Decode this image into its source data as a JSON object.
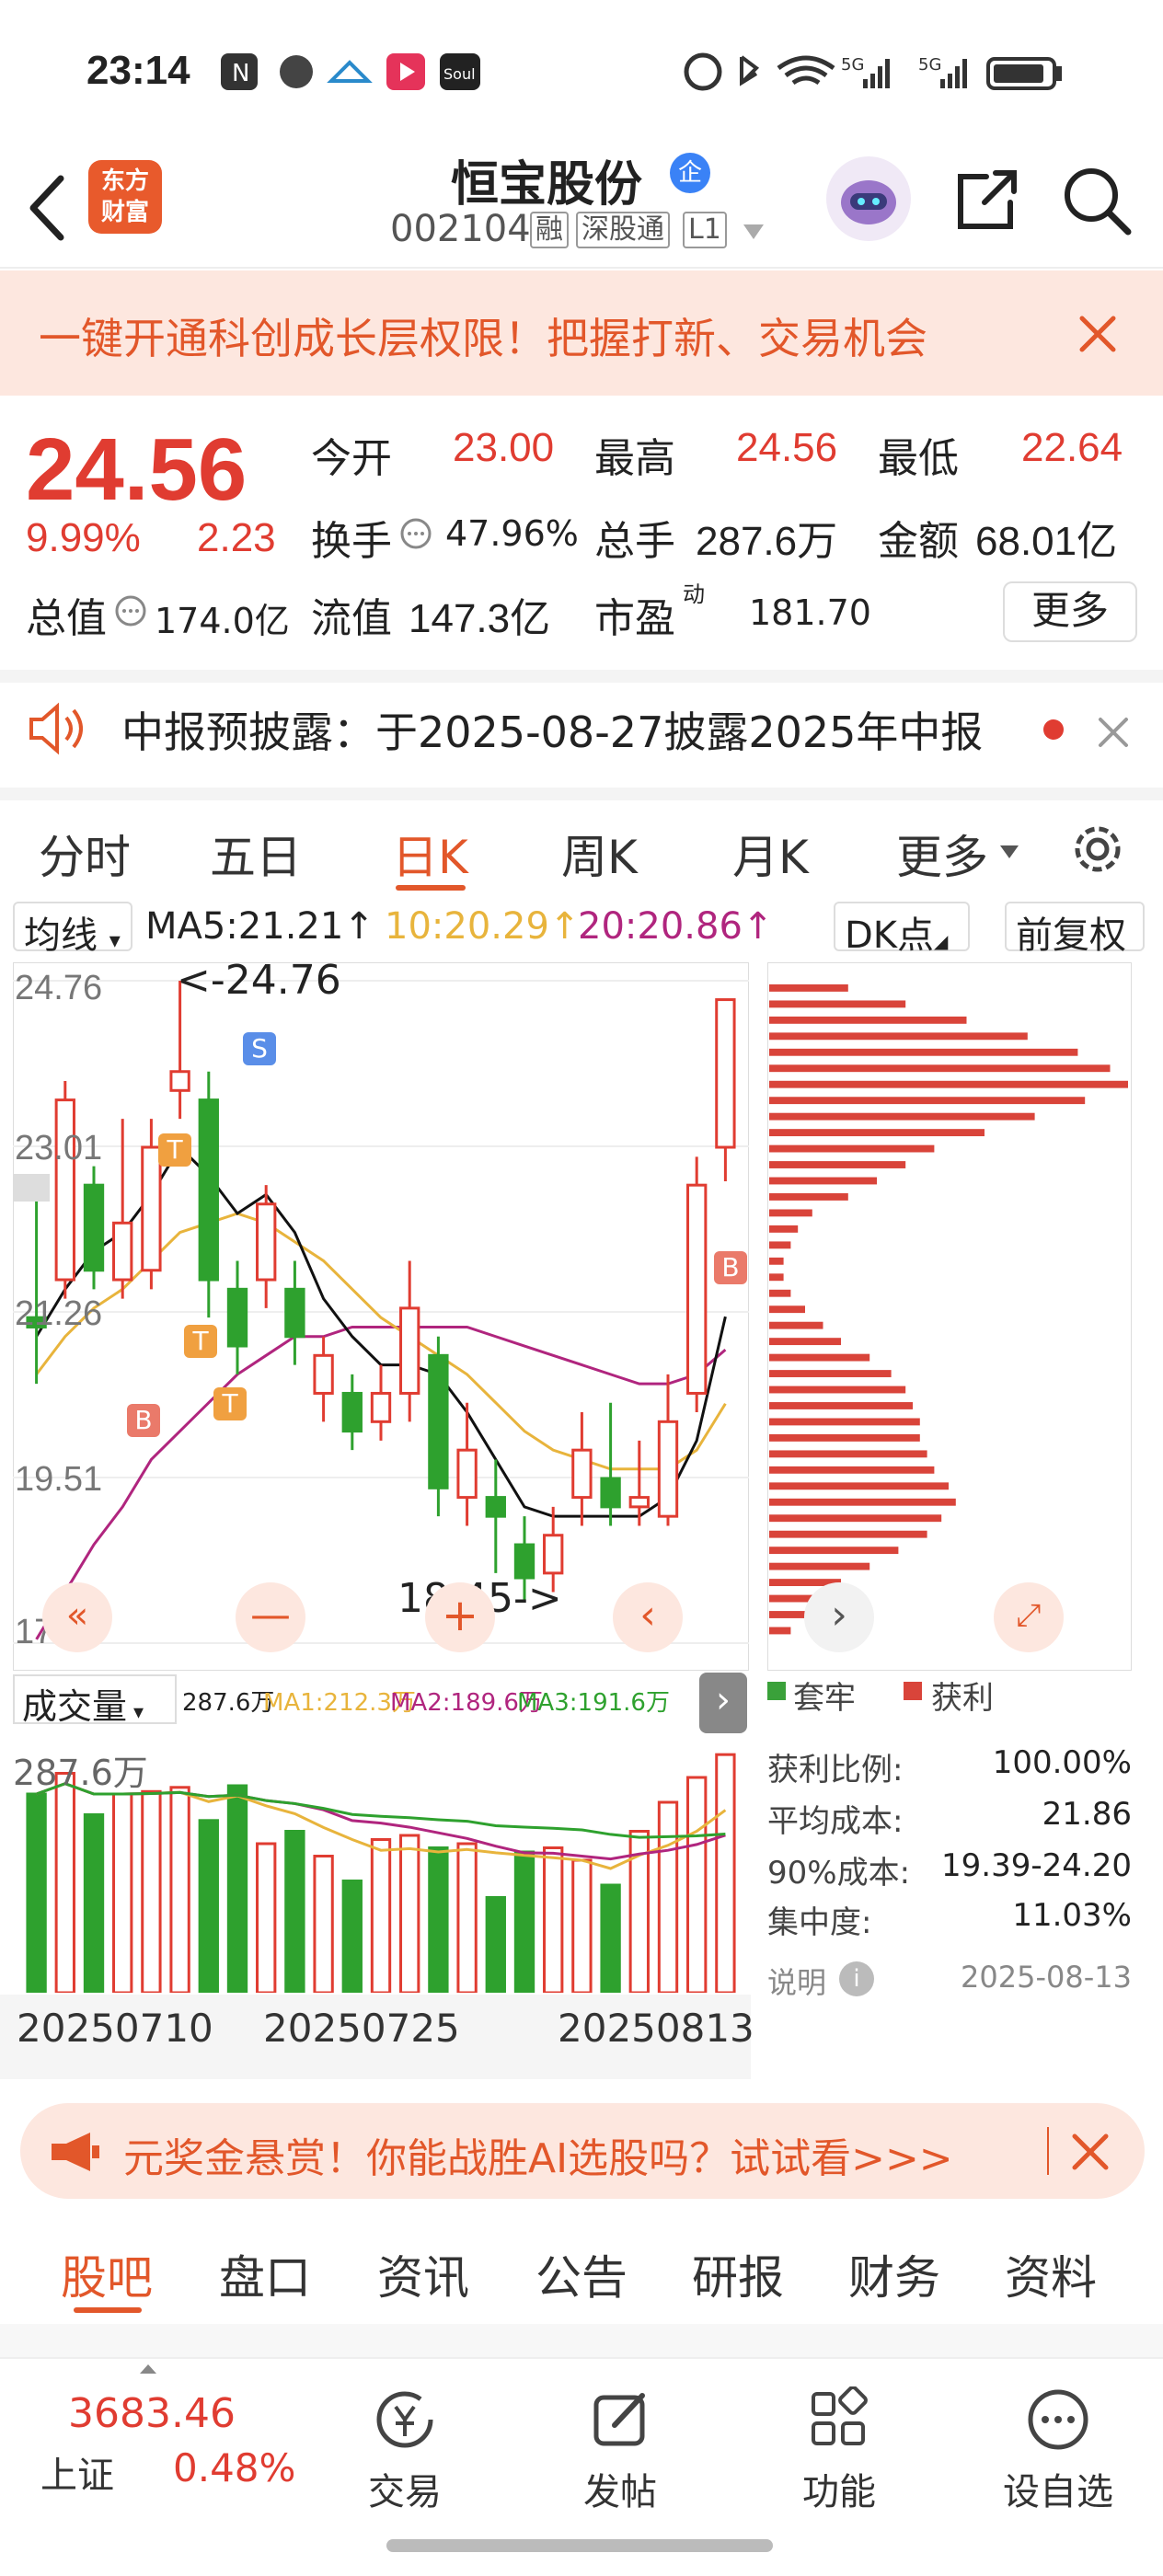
{
  "status": {
    "time": "23:14",
    "network_labels": [
      "5G",
      "5G"
    ]
  },
  "header": {
    "name": "恒宝股份",
    "badge": "企",
    "code": "002104",
    "tags": [
      "融",
      "深股通",
      "L1"
    ],
    "logo_text": "东方财富",
    "icons": [
      "back-arrow-icon",
      "avatar",
      "share-icon",
      "search-icon"
    ]
  },
  "banner": {
    "text": "一键开通科创成长层权限！把握打新、交易机会"
  },
  "quote": {
    "price": "24.56",
    "pct": "9.99%",
    "chg": "2.23",
    "open_label": "今开",
    "open": "23.00",
    "high_label": "最高",
    "high": "24.56",
    "low_label": "最低",
    "low": "22.64",
    "turnover_label": "换手",
    "turnover": "47.96%",
    "vol_label": "总手",
    "vol": "287.6万",
    "amt_label": "金额",
    "amt": "68.01亿",
    "mcap_label": "总值",
    "mcap": "174.0亿",
    "float_label": "流值",
    "float": "147.3亿",
    "pe_label": "市盈",
    "pe_sup": "动",
    "pe": "181.70",
    "more": "更多"
  },
  "notice": {
    "text": "中报预披露：于2025-08-27披露2025年中报"
  },
  "tabs": {
    "items": [
      "分时",
      "五日",
      "日K",
      "周K",
      "月K",
      "更多"
    ],
    "active": 2
  },
  "chartbar": {
    "ma_label": "均线",
    "ma5": "MA5:21.21",
    "ma10": "10:20.29",
    "ma20": "20:20.86",
    "dk": "DK点",
    "fq": "前复权",
    "arrow": "↑"
  },
  "chart_data": {
    "type": "candlestick",
    "y_ticks": [
      "24.76",
      "23.01",
      "21.26",
      "19.51",
      "17.76"
    ],
    "ylim": [
      17.76,
      24.76
    ],
    "x_labels": [
      "20250710",
      "20250725",
      "20250813"
    ],
    "annotations": [
      "<-24.76",
      "18.45->"
    ],
    "markers": [
      "T",
      "T",
      "T",
      "B",
      "B",
      "S"
    ],
    "candles": [
      {
        "o": 21.2,
        "c": 21.1,
        "h": 22.5,
        "l": 20.5
      },
      {
        "o": 21.6,
        "c": 23.5,
        "h": 23.7,
        "l": 21.4
      },
      {
        "o": 22.6,
        "c": 21.7,
        "h": 22.8,
        "l": 21.5
      },
      {
        "o": 21.6,
        "c": 22.2,
        "h": 23.3,
        "l": 21.4
      },
      {
        "o": 21.7,
        "c": 23.0,
        "h": 23.3,
        "l": 21.5
      },
      {
        "o": 23.6,
        "c": 23.8,
        "h": 24.76,
        "l": 23.3
      },
      {
        "o": 23.5,
        "c": 21.6,
        "h": 23.8,
        "l": 21.2
      },
      {
        "o": 21.5,
        "c": 20.9,
        "h": 21.8,
        "l": 20.6
      },
      {
        "o": 21.6,
        "c": 22.4,
        "h": 22.6,
        "l": 21.3
      },
      {
        "o": 21.5,
        "c": 21.0,
        "h": 21.8,
        "l": 20.7
      },
      {
        "o": 20.4,
        "c": 20.8,
        "h": 21.0,
        "l": 20.1
      },
      {
        "o": 20.4,
        "c": 20.0,
        "h": 20.6,
        "l": 19.8
      },
      {
        "o": 20.1,
        "c": 20.4,
        "h": 20.7,
        "l": 19.9
      },
      {
        "o": 20.4,
        "c": 21.3,
        "h": 21.8,
        "l": 20.1
      },
      {
        "o": 20.8,
        "c": 19.4,
        "h": 21.0,
        "l": 19.1
      },
      {
        "o": 19.3,
        "c": 19.8,
        "h": 20.3,
        "l": 19.0
      },
      {
        "o": 19.3,
        "c": 19.1,
        "h": 19.7,
        "l": 18.5
      },
      {
        "o": 18.8,
        "c": 18.45,
        "h": 19.1,
        "l": 18.2
      },
      {
        "o": 18.5,
        "c": 18.9,
        "h": 19.2,
        "l": 18.3
      },
      {
        "o": 19.3,
        "c": 19.8,
        "h": 20.2,
        "l": 19.0
      },
      {
        "o": 19.5,
        "c": 19.2,
        "h": 20.3,
        "l": 19.0
      },
      {
        "o": 19.2,
        "c": 19.3,
        "h": 19.9,
        "l": 19.0
      },
      {
        "o": 19.1,
        "c": 20.1,
        "h": 20.6,
        "l": 19.0
      },
      {
        "o": 20.4,
        "c": 22.6,
        "h": 22.9,
        "l": 20.2
      },
      {
        "o": 23.0,
        "c": 24.56,
        "h": 24.56,
        "l": 22.64
      }
    ],
    "ma_lines": {
      "ma5": [
        21.0,
        21.5,
        21.9,
        22.1,
        22.5,
        23.0,
        22.7,
        22.3,
        22.5,
        22.1,
        21.4,
        21.0,
        20.7,
        20.7,
        20.6,
        20.2,
        19.7,
        19.2,
        19.1,
        19.1,
        19.1,
        19.1,
        19.3,
        19.9,
        21.21
      ],
      "ma10": [
        20.6,
        21.0,
        21.3,
        21.5,
        21.8,
        22.1,
        22.2,
        22.3,
        22.2,
        22.0,
        21.8,
        21.5,
        21.2,
        21.0,
        20.8,
        20.6,
        20.3,
        20.0,
        19.8,
        19.7,
        19.6,
        19.6,
        19.6,
        19.8,
        20.29
      ],
      "ma20": [
        17.8,
        18.3,
        18.8,
        19.2,
        19.7,
        20.0,
        20.3,
        20.6,
        20.8,
        21.0,
        21.0,
        21.1,
        21.1,
        21.1,
        21.1,
        21.1,
        21.0,
        20.9,
        20.8,
        20.7,
        20.6,
        20.5,
        20.5,
        20.6,
        20.86
      ]
    },
    "volume": {
      "label": "成交量",
      "top": "287.6万",
      "ma1": "MA1:212.3万",
      "ma2": "MA2:189.6万",
      "ma3": "MA3:191.6万",
      "values": [
        240,
        265,
        215,
        240,
        243,
        248,
        208,
        250,
        180,
        195,
        165,
        135,
        185,
        190,
        175,
        180,
        115,
        170,
        175,
        160,
        130,
        195,
        230,
        260,
        287.6
      ]
    }
  },
  "chips": {
    "legend_loss": "套牢",
    "legend_profit": "获利",
    "rows": [
      [
        "获利比例:",
        "100.00%"
      ],
      [
        "平均成本:",
        "21.86"
      ],
      [
        "90%成本:",
        "19.39-24.20"
      ],
      [
        "集中度:",
        "11.03%"
      ]
    ],
    "note": "说明",
    "date": "2025-08-13",
    "bars": [
      0.22,
      0.38,
      0.55,
      0.72,
      0.86,
      0.95,
      1.0,
      0.88,
      0.74,
      0.6,
      0.46,
      0.38,
      0.3,
      0.22,
      0.12,
      0.08,
      0.06,
      0.04,
      0.04,
      0.06,
      0.1,
      0.15,
      0.2,
      0.28,
      0.34,
      0.38,
      0.4,
      0.42,
      0.42,
      0.44,
      0.46,
      0.5,
      0.52,
      0.48,
      0.44,
      0.36,
      0.28,
      0.2,
      0.14,
      0.1,
      0.06
    ]
  },
  "promo": {
    "text": "元奖金悬赏！你能战胜AI选股吗？试试看>>>"
  },
  "subtabs": [
    "股吧",
    "盘口",
    "资讯",
    "公告",
    "研报",
    "财务",
    "资料"
  ],
  "index": {
    "value": "3683.46",
    "name": "上证",
    "pct": "0.48%"
  },
  "nav": [
    "交易",
    "发帖",
    "功能",
    "设自选"
  ],
  "colors": {
    "up": "#e03c31",
    "down": "#2ea12e",
    "ma5": "#111111",
    "ma10": "#e8b43c",
    "ma20": "#b0257e",
    "accent": "#e85a2c"
  }
}
